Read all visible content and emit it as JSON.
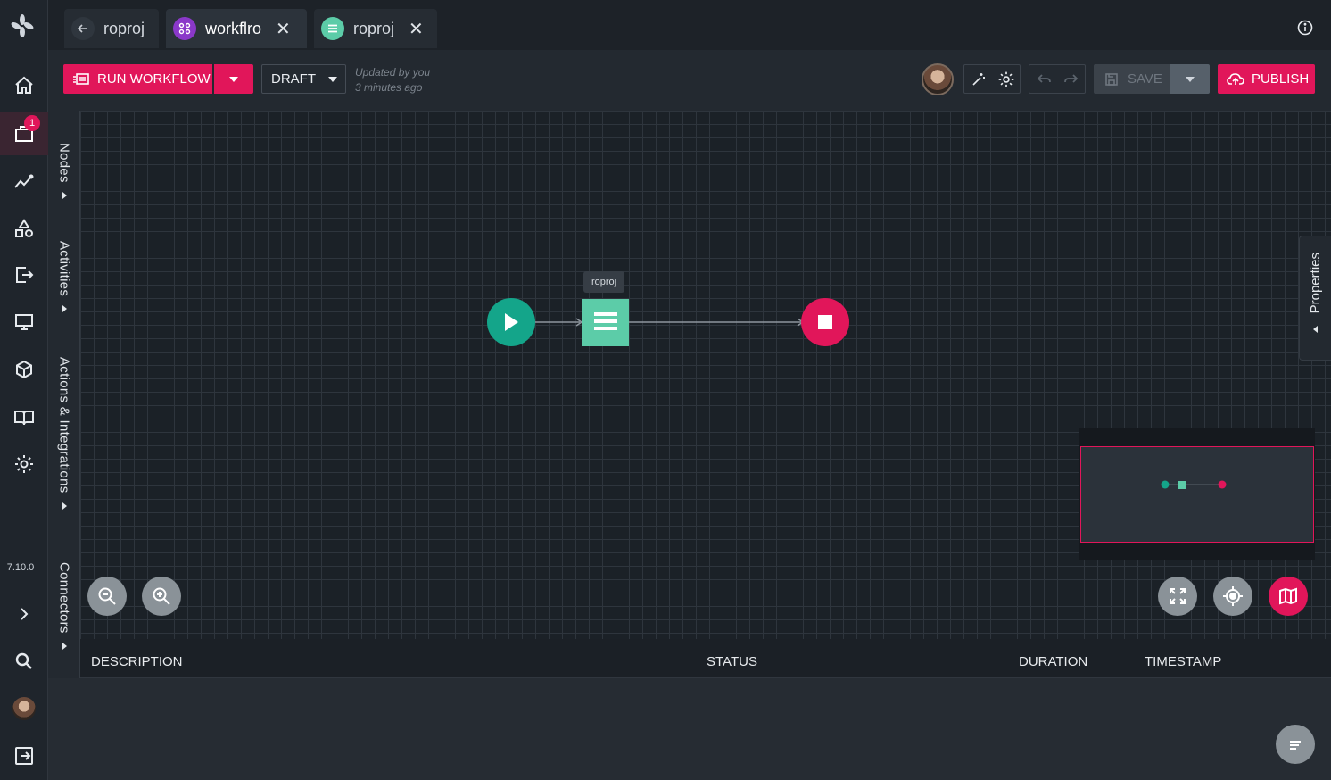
{
  "app": {
    "version": "7.10.0",
    "nav_badge_count": "1",
    "brand_color": "#e1165a"
  },
  "tabs": [
    {
      "label": "roproj",
      "icon": "arrow-left-icon"
    },
    {
      "label": "workflro",
      "icon": "workflow-icon"
    },
    {
      "label": "roproj",
      "icon": "list-icon"
    }
  ],
  "toolbar": {
    "run_label": "RUN WORKFLOW",
    "status_label": "DRAFT",
    "updated_line1": "Updated by you",
    "updated_line2": "3 minutes ago",
    "save_label": "SAVE",
    "publish_label": "PUBLISH"
  },
  "palette": {
    "nodes": "Nodes",
    "activities": "Activities",
    "actions": "Actions & Integrations",
    "connectors": "Connectors"
  },
  "canvas": {
    "properties_label": "Properties",
    "node_tooltip": "roproj"
  },
  "log_table": {
    "columns": [
      "DESCRIPTION",
      "STATUS",
      "DURATION",
      "TIMESTAMP"
    ]
  }
}
